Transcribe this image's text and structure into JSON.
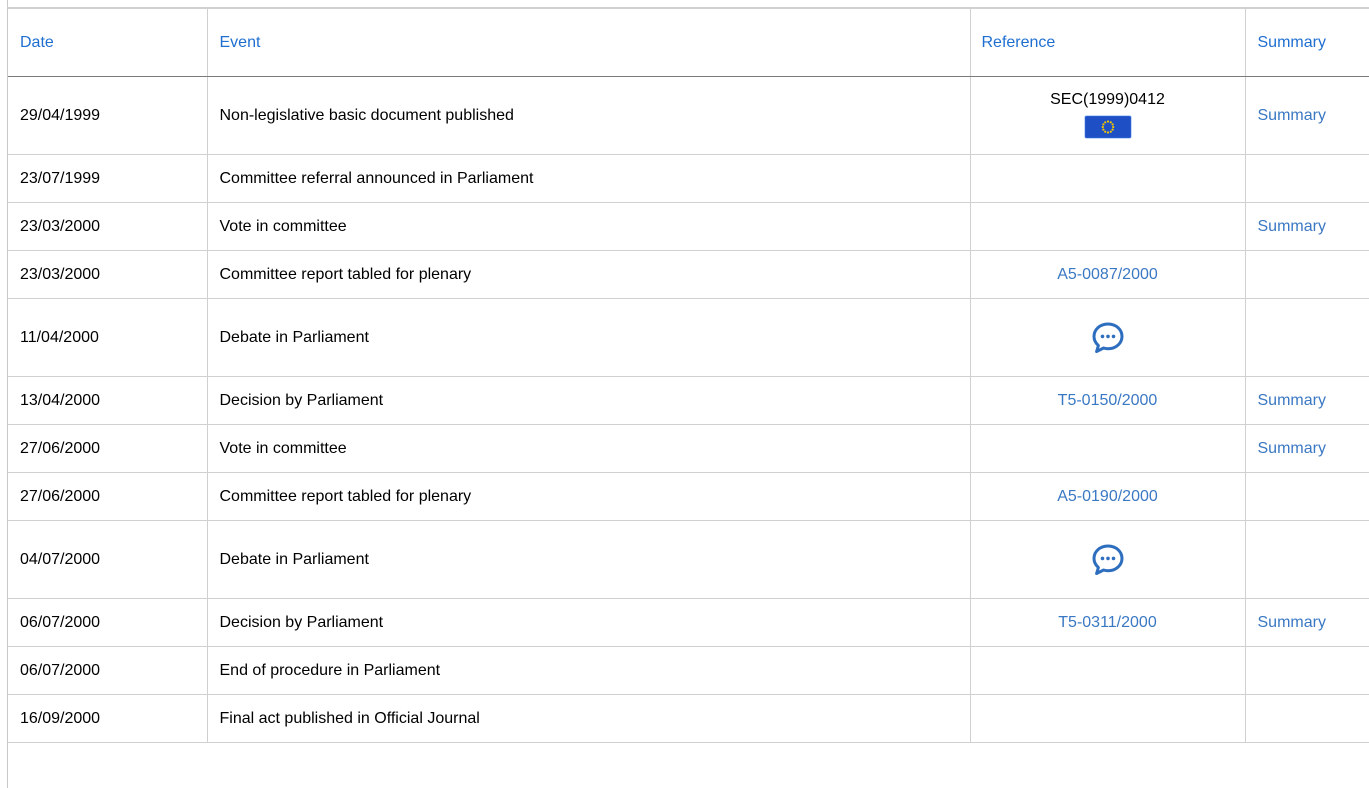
{
  "table": {
    "headers": {
      "date": "Date",
      "event": "Event",
      "reference": "Reference",
      "summary": "Summary"
    },
    "rows": [
      {
        "date": "29/04/1999",
        "event": "Non-legislative basic document published",
        "reference": "SEC(1999)0412",
        "reference_type": "document",
        "summary": "Summary"
      },
      {
        "date": "23/07/1999",
        "event": "Committee referral announced in Parliament",
        "reference": "",
        "reference_type": "none",
        "summary": ""
      },
      {
        "date": "23/03/2000",
        "event": "Vote in committee",
        "reference": "",
        "reference_type": "none",
        "summary": "Summary"
      },
      {
        "date": "23/03/2000",
        "event": "Committee report tabled for plenary",
        "reference": "A5-0087/2000",
        "reference_type": "link",
        "summary": ""
      },
      {
        "date": "11/04/2000",
        "event": "Debate in Parliament",
        "reference": "",
        "reference_type": "debate",
        "summary": ""
      },
      {
        "date": "13/04/2000",
        "event": "Decision by Parliament",
        "reference": "T5-0150/2000",
        "reference_type": "link",
        "summary": "Summary"
      },
      {
        "date": "27/06/2000",
        "event": "Vote in committee",
        "reference": "",
        "reference_type": "none",
        "summary": "Summary"
      },
      {
        "date": "27/06/2000",
        "event": "Committee report tabled for plenary",
        "reference": "A5-0190/2000",
        "reference_type": "link",
        "summary": ""
      },
      {
        "date": "04/07/2000",
        "event": "Debate in Parliament",
        "reference": "",
        "reference_type": "debate",
        "summary": ""
      },
      {
        "date": "06/07/2000",
        "event": "Decision by Parliament",
        "reference": "T5-0311/2000",
        "reference_type": "link",
        "summary": "Summary"
      },
      {
        "date": "06/07/2000",
        "event": "End of procedure in Parliament",
        "reference": "",
        "reference_type": "none",
        "summary": ""
      },
      {
        "date": "16/09/2000",
        "event": "Final act published in Official Journal",
        "reference": "",
        "reference_type": "none",
        "summary": ""
      }
    ]
  },
  "icons": {
    "eu_flag": "eu-flag-icon",
    "debate": "speech-bubble-icon"
  },
  "colors": {
    "header_text": "#1f6fd1",
    "link": "#3a78c3",
    "flag_blue": "#1f4fc4",
    "flag_stars": "#f2c500",
    "debate_blue": "#2e6ebf",
    "grid": "#d0d0d0"
  }
}
